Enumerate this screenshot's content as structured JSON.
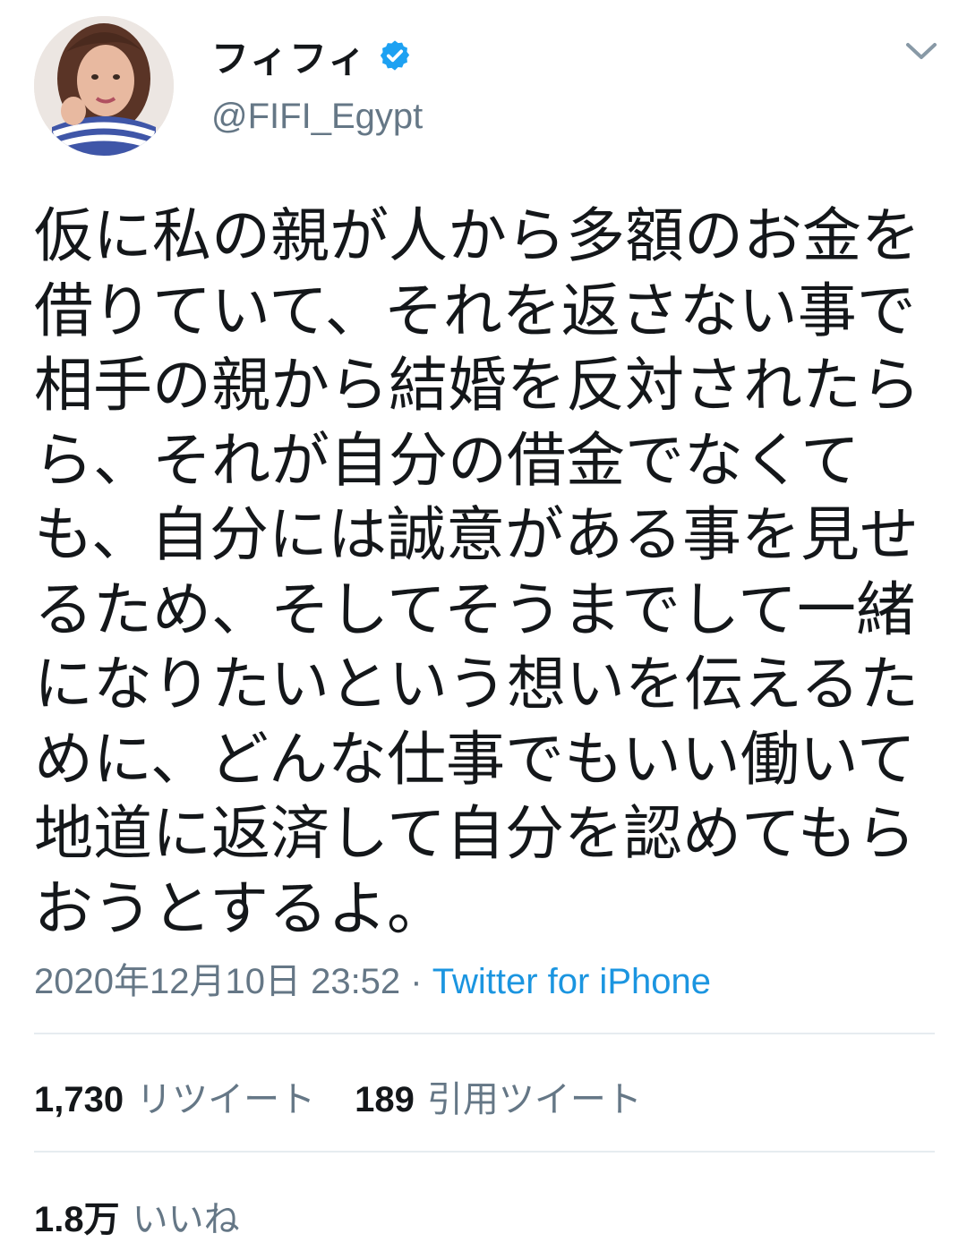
{
  "tweet": {
    "display_name": "フィフィ",
    "handle": "@FIFI_Egypt",
    "verified": true,
    "text_lines": [
      "仮に私の親が人から多額のお金を",
      "借りていて、それを返さない事で",
      "相手の親から結婚を反対されたら",
      "ら、それが自分の借金でなくて",
      "も、自分には誠意がある事を見せ",
      "るため、そしてそうまでして一緒",
      "になりたいという想いを伝えるた",
      "めに、どんな仕事でもいい働いて",
      "地道に返済して自分を認めてもら",
      "おうとするよ。"
    ],
    "timestamp": "2020年12月10日 23:52",
    "separator": " · ",
    "source": "Twitter for iPhone",
    "retweets_count": "1,730",
    "retweets_label": "リツイート",
    "quotes_count": "189",
    "quotes_label": "引用ツイート",
    "likes_count": "1.8万",
    "likes_label": "いいね"
  },
  "icons": {
    "verified": "verified-badge-icon",
    "menu": "chevron-down-icon"
  },
  "colors": {
    "text": "#14171a",
    "secondary": "#657786",
    "link": "#1b95e0",
    "verified": "#1da1f2",
    "divider": "#e6ecf0"
  }
}
